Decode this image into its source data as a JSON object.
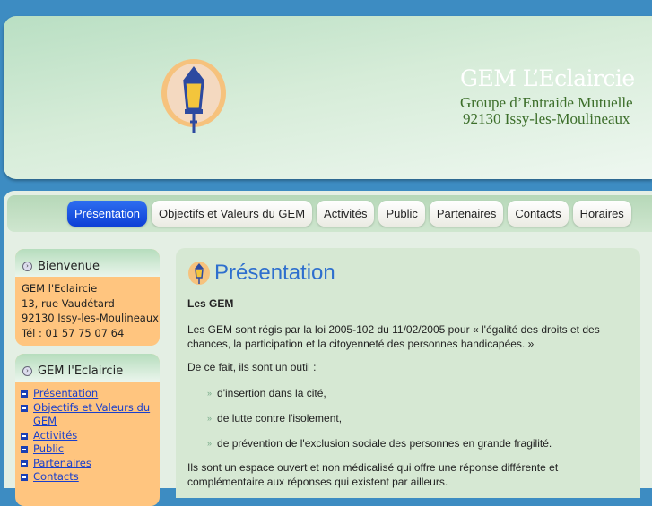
{
  "header": {
    "title": "GEM L’Eclaircie",
    "subtitle_line1": "Groupe d’Entraide Mutuelle",
    "subtitle_line2": "92130 Issy-les-Moulineaux"
  },
  "nav": {
    "tabs": [
      "Présentation",
      "Objectifs et Valeurs du GEM",
      "Activités",
      "Public",
      "Partenaires",
      "Contacts",
      "Horaires"
    ],
    "active": "Présentation"
  },
  "sidebar": {
    "welcome": {
      "title": "Bienvenue",
      "lines": [
        "GEM l'Eclaircie",
        "13, rue Vaudétard",
        "92130 Issy-les-Moulineaux",
        "Tél : 01 57 75 07 64"
      ]
    },
    "menu": {
      "title": "GEM l'Eclaircie",
      "items": [
        "Présentation",
        "Objectifs et Valeurs du GEM",
        "Activités",
        "Public",
        "Partenaires",
        "Contacts"
      ]
    }
  },
  "content": {
    "title": "Présentation",
    "subtitle": "Les GEM",
    "p1": "Les GEM sont régis par la loi 2005-102 du 11/02/2005 pour « l'égalité des droits et des chances, la participation et la citoyenneté des personnes handicapées. »",
    "p2": "De ce fait, ils sont un outil :",
    "bullets": [
      "d'insertion dans la cité,",
      "de lutte contre l'isolement,",
      "de prévention de l'exclusion sociale des personnes en grande fragilité."
    ],
    "p3": "Ils sont un espace ouvert et non médicalisé qui offre une réponse différente et complémentaire aux réponses qui existent par ailleurs."
  },
  "colors": {
    "background": "#3d8cc2",
    "active_tab": "#1a4fe0",
    "sidebar_box": "#ffc57f",
    "title": "#2e6fce"
  }
}
